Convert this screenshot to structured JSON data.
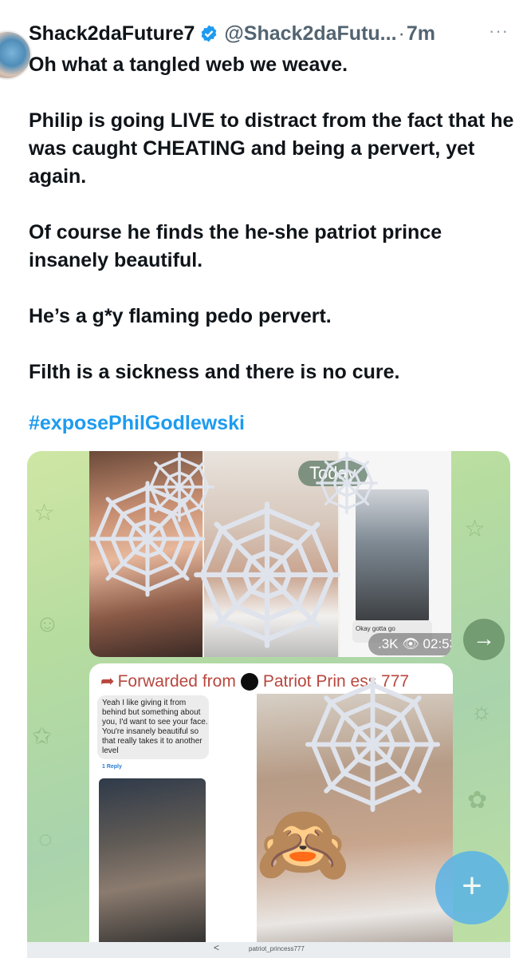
{
  "tweet": {
    "display_name": "Shack2daFuture7",
    "handle": "@Shack2daFutu...",
    "separator": "·",
    "time": "7m",
    "more_icon": "···",
    "paragraphs": [
      "Oh what a tangled web we weave.",
      "Philip is going LIVE to distract from the fact that he was caught CHEATING and being a pervert, yet again.",
      "Of course he finds the he-she patriot prince insanely beautiful.",
      "He’s a g*y flaming pedo pervert.",
      "Filth is a sickness and there is no cure."
    ],
    "hashtag": "#exposePhilGodlewski"
  },
  "media": {
    "date_pill": "Today",
    "meta_pill": ".3K 👁 02:53 PM",
    "small_caption": "Okay gotta go",
    "forwarded_label": "Forwarded from",
    "forwarded_source": "Patriot Prin  ess 777",
    "message_text": "Yeah I like giving it from behind but something about you, I'd want to see your face. You're insanely beautiful so that really takes it to another level",
    "reply_label": "1 Reply",
    "bottom_text": "patriot_princess777",
    "share_icon": "→",
    "fab_icon": "+",
    "emoji": "🙈"
  },
  "colors": {
    "link": "#1d9bf0",
    "verified": "#1d9bf0",
    "forward": "#b8473e",
    "fab": "#59b3e6"
  }
}
